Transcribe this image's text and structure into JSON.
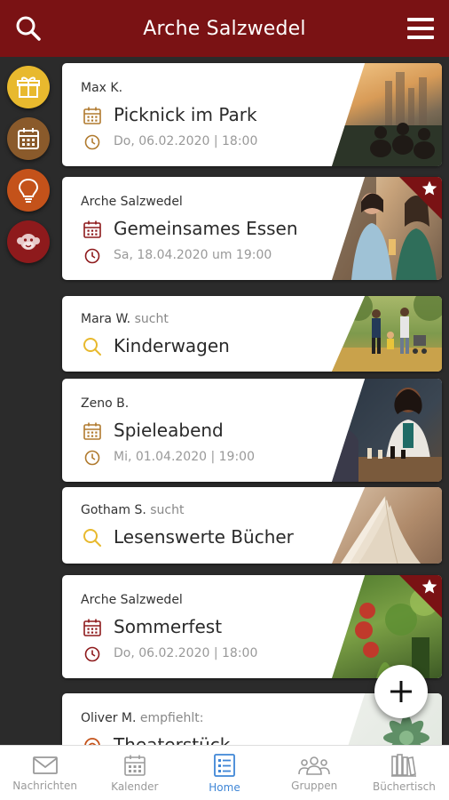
{
  "header": {
    "title": "Arche Salzwedel",
    "search_icon": "search-icon",
    "menu_icon": "hamburger-menu-icon",
    "color": "#7a1214"
  },
  "rail": [
    {
      "icon": "gift-icon",
      "color": "#e8b92e"
    },
    {
      "icon": "calendar-icon",
      "color": "#8a5a2b"
    },
    {
      "icon": "lightbulb-icon",
      "color": "#c4521a"
    },
    {
      "icon": "monkey-icon",
      "color": "#8e1a1c"
    }
  ],
  "cards": [
    {
      "author": "Max K.",
      "suffix": "",
      "title": "Picknick im Park",
      "meta": "Do, 06.02.2020 | 18:00",
      "type": "event",
      "accent": "#b07a2e",
      "starred": false,
      "photo": "picnic-park-photo"
    },
    {
      "author": "Arche Salzwedel",
      "suffix": "",
      "title": "Gemeinsames Essen",
      "meta": "Sa, 18.04.2020 um 19:00",
      "type": "event",
      "accent": "#8e1a1c",
      "starred": true,
      "photo": "friends-dinner-photo"
    },
    {
      "author": "Mara W.",
      "suffix": " sucht",
      "title": "Kinderwagen",
      "meta": "",
      "type": "search",
      "accent": "#e8b92e",
      "starred": false,
      "photo": "family-walk-photo"
    },
    {
      "author": "Zeno B.",
      "suffix": "",
      "title": "Spieleabend",
      "meta": "Mi, 01.04.2020 | 19:00",
      "type": "event",
      "accent": "#b07a2e",
      "starred": false,
      "photo": "chess-game-photo"
    },
    {
      "author": "Gotham S.",
      "suffix": " sucht",
      "title": "Lesenswerte Bücher",
      "meta": "",
      "type": "search",
      "accent": "#e8b92e",
      "starred": false,
      "photo": "open-book-photo"
    },
    {
      "author": "Arche Salzwedel",
      "suffix": "",
      "title": "Sommerfest",
      "meta": "Do, 06.02.2020 | 18:00",
      "type": "event",
      "accent": "#8e1a1c",
      "starred": true,
      "photo": "garden-plants-photo"
    },
    {
      "author": "Oliver M.",
      "suffix": " empfiehlt:",
      "title": "Theaterstück",
      "meta": "",
      "type": "recommend",
      "accent": "#c4521a",
      "starred": false,
      "photo": "succulent-photo"
    }
  ],
  "fab": {
    "icon": "plus-icon"
  },
  "nav": [
    {
      "label": "Nachrichten",
      "icon": "envelope-icon",
      "active": false
    },
    {
      "label": "Kalender",
      "icon": "calendar-icon",
      "active": false
    },
    {
      "label": "Home",
      "icon": "home-list-icon",
      "active": true
    },
    {
      "label": "Gruppen",
      "icon": "group-icon",
      "active": false
    },
    {
      "label": "Büchertisch",
      "icon": "books-icon",
      "active": false
    }
  ]
}
